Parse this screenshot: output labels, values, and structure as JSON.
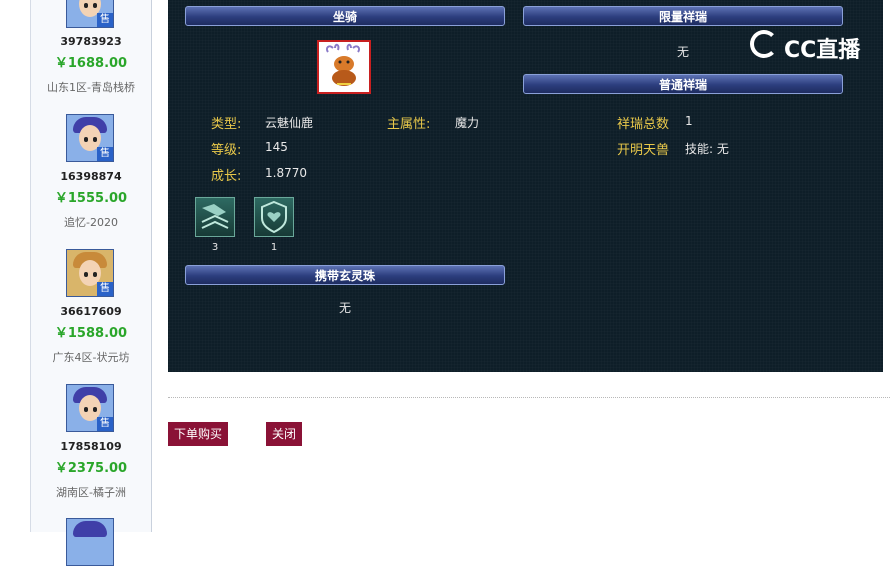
{
  "sidebar": {
    "sale_badge": "售",
    "items": [
      {
        "id": "39783923",
        "price": "￥1688.00",
        "server": "山东1区-青岛栈桥"
      },
      {
        "id": "16398874",
        "price": "￥1555.00",
        "server": "追忆-2020"
      },
      {
        "id": "36617609",
        "price": "￥1588.00",
        "server": "广东4区-状元坊"
      },
      {
        "id": "17858109",
        "price": "￥2375.00",
        "server": "湖南区-橘子洲"
      }
    ]
  },
  "panel": {
    "mount_header": "坐骑",
    "limited_header": "限量祥瑞",
    "limited_value": "无",
    "normal_header": "普通祥瑞",
    "attrs": {
      "type_label": "类型:",
      "type_value": "云魅仙鹿",
      "main_attr_label": "主属性:",
      "main_attr_value": "魔力",
      "level_label": "等级:",
      "level_value": "145",
      "growth_label": "成长:",
      "growth_value": "1.8770",
      "total_label": "祥瑞总数",
      "total_value": "1",
      "beast_label": "开明天兽",
      "beast_skill": "技能: 无"
    },
    "skills": [
      {
        "icon": "skill-icon-1",
        "count": "3"
      },
      {
        "icon": "skill-icon-2",
        "count": "1"
      }
    ],
    "orb_header": "携带玄灵珠",
    "orb_value": "无"
  },
  "logo": {
    "text": "CC直播"
  },
  "actions": {
    "buy": "下单购买",
    "close": "关闭"
  },
  "colors": {
    "panel_bg": "#0e1e28",
    "label_gold": "#e8c84a",
    "price_green": "#2aa62a",
    "button_red": "#8a1236"
  }
}
